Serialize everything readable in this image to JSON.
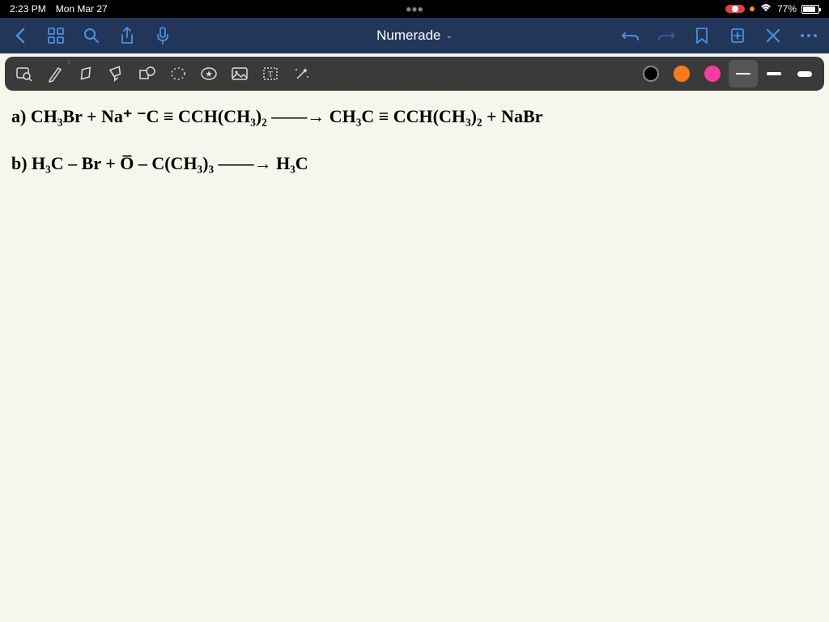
{
  "status": {
    "time": "2:23 PM",
    "date": "Mon Mar 27",
    "battery_pct": "77%"
  },
  "nav": {
    "title": "Numerade"
  },
  "handwriting": {
    "line_a": "a)  CH₃Br  +  Na⁺ ⁻C ≡ CCH(CH₃)₂  ——→ CH₃C ≡ CCH(CH₃)₂ + NaBr",
    "line_b": "b)  H₃C – Br + O̅ – C(CH₃)₃  ——→ H₃C"
  },
  "tools": {
    "names": [
      "image-search",
      "pen",
      "eraser",
      "highlighter",
      "shapes",
      "lasso",
      "favorite",
      "image",
      "text",
      "magic",
      "color-black",
      "color-orange",
      "color-pink",
      "stroke-thin",
      "stroke-med",
      "stroke-thick"
    ]
  },
  "colors": {
    "accent": "#4a90e2",
    "navbar": "#22365a",
    "toolbar": "#3a3a3a",
    "canvas": "#f7f6ed"
  }
}
